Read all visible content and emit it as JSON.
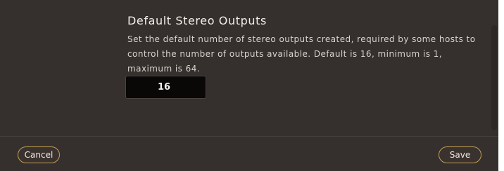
{
  "settings": {
    "title": "Default Stereo Outputs",
    "description": "Set the default number of stereo outputs created, required by some hosts to control the number of outputs available. Default is 16, minimum is 1, maximum is 64.",
    "value": "16"
  },
  "footer": {
    "cancel_label": "Cancel",
    "save_label": "Save"
  },
  "colors": {
    "background": "#352f2d",
    "input_background": "#090807",
    "button_border": "#c5a152"
  }
}
